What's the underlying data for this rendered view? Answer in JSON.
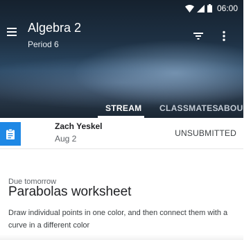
{
  "status_bar": {
    "time": "06:00"
  },
  "header": {
    "title": "Algebra 2",
    "subtitle": "Period 6"
  },
  "tabs": [
    {
      "label": "STREAM",
      "active": true
    },
    {
      "label": "CLASSMATES",
      "active": false
    },
    {
      "label": "ABOU",
      "active": false
    }
  ],
  "assignment": {
    "student_name": "Zach Yeskel",
    "date": "Aug 2",
    "status": "UNSUBMITTED",
    "due": "Due tomorrow",
    "title": "Parabolas worksheet",
    "description": "Draw individual points in one color, and then connect them with a curve in a different color"
  },
  "colors": {
    "accent": "#1e88e5",
    "tab_indicator": "#ffffff"
  },
  "icons": [
    "menu-icon",
    "filter-icon",
    "more-vert-icon",
    "wifi-icon",
    "signal-icon",
    "battery-icon",
    "assignment-icon"
  ]
}
